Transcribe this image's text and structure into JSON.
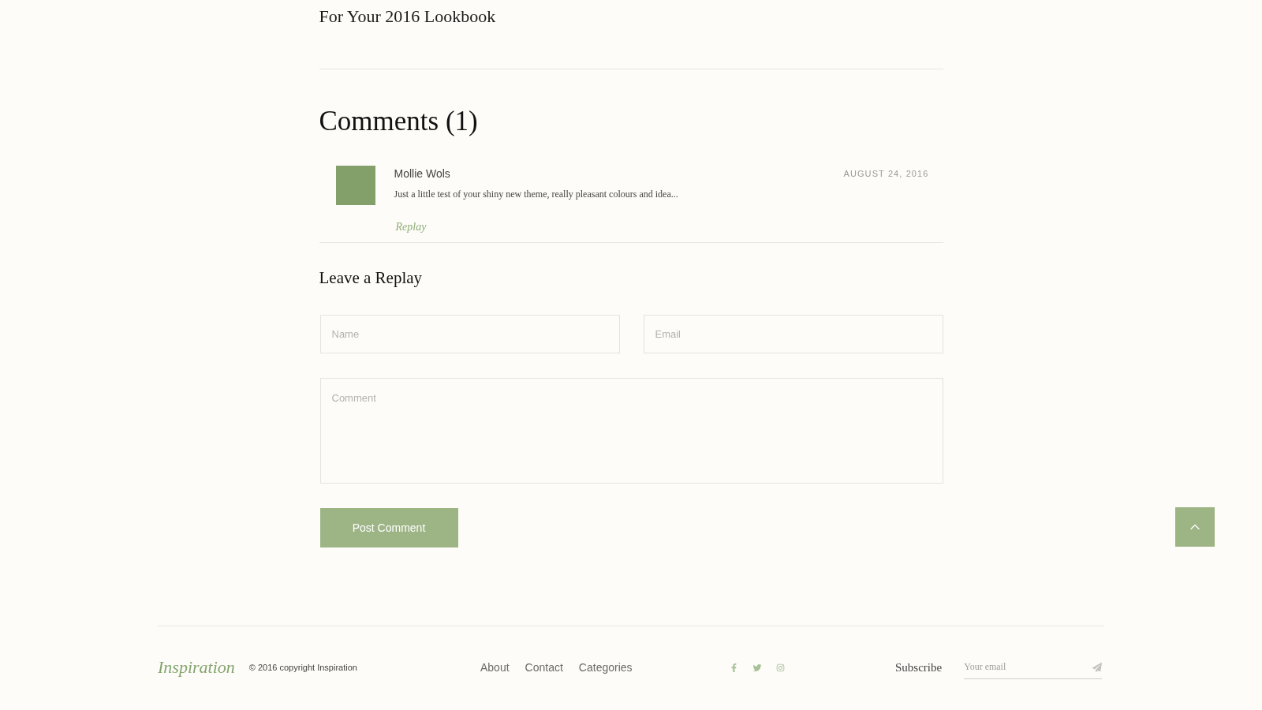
{
  "related_posts": [
    {
      "title": "For Your 2016 Lookbook"
    }
  ],
  "comments_section": {
    "title": "Comments (1)",
    "comments": [
      {
        "author": "Mollie Wols",
        "date": "AUGUST 24, 2016",
        "text": "Just a little test of your shiny new theme, really pleasant colours and idea...",
        "reply_link": "Replay"
      }
    ]
  },
  "reply_form": {
    "title": "Leave a Replay",
    "fields": [
      {
        "kind": "input",
        "placeholder": "Name"
      },
      {
        "kind": "input",
        "placeholder": "Email"
      },
      {
        "kind": "textarea",
        "placeholder": "Comment"
      }
    ],
    "submit": "Post Comment"
  },
  "footer": {
    "logo": "Inspiration",
    "copyright": "© 2016 copyright Inspiration",
    "nav": [
      "About",
      "Contact",
      "Categories"
    ],
    "subscribe": {
      "label": "Subscribe",
      "placeholder": "Your email"
    }
  }
}
